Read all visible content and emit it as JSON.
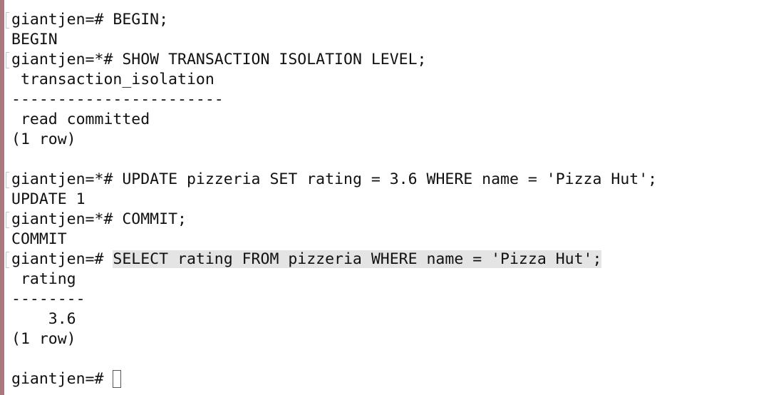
{
  "terminal": {
    "lines": [
      {
        "prompt": "giantjen=# ",
        "text": "BEGIN;",
        "mark": true
      },
      {
        "prompt": "",
        "text": "BEGIN",
        "mark": false
      },
      {
        "prompt": "giantjen=*# ",
        "text": "SHOW TRANSACTION ISOLATION LEVEL;",
        "mark": true
      },
      {
        "prompt": "",
        "text": " transaction_isolation",
        "mark": false
      },
      {
        "prompt": "",
        "text": "-----------------------",
        "mark": false
      },
      {
        "prompt": "",
        "text": " read committed",
        "mark": false
      },
      {
        "prompt": "",
        "text": "(1 row)",
        "mark": false
      },
      {
        "prompt": "",
        "text": "",
        "mark": false
      },
      {
        "prompt": "giantjen=*# ",
        "text": "UPDATE pizzeria SET rating = 3.6 WHERE name = 'Pizza Hut';",
        "mark": true
      },
      {
        "prompt": "",
        "text": "UPDATE 1",
        "mark": false
      },
      {
        "prompt": "giantjen=*# ",
        "text": "COMMIT;",
        "mark": true
      },
      {
        "prompt": "",
        "text": "COMMIT",
        "mark": false
      },
      {
        "prompt": "giantjen=# ",
        "text": "SELECT rating FROM pizzeria WHERE name = 'Pizza Hut';",
        "mark": true,
        "selected": true
      },
      {
        "prompt": "",
        "text": " rating",
        "mark": false
      },
      {
        "prompt": "",
        "text": "--------",
        "mark": false
      },
      {
        "prompt": "",
        "text": "    3.6",
        "mark": false
      },
      {
        "prompt": "",
        "text": "(1 row)",
        "mark": false
      },
      {
        "prompt": "",
        "text": "",
        "mark": false
      }
    ],
    "current_prompt": "giantjen=# "
  }
}
